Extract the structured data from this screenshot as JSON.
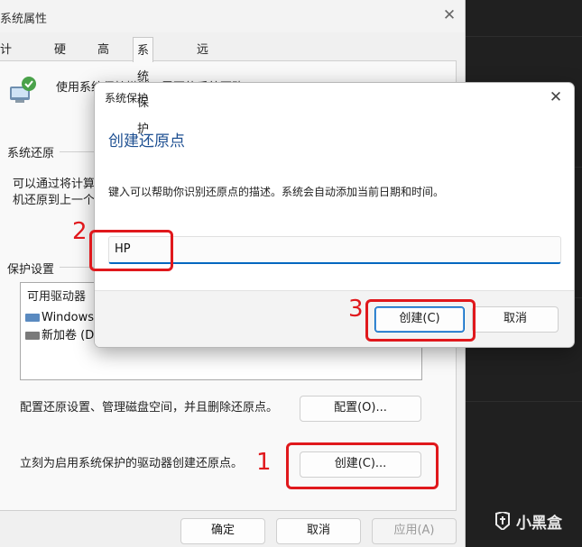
{
  "parent_window": {
    "title": "系统属性",
    "close_glyph": "✕",
    "tabs": [
      {
        "label": "计算机名"
      },
      {
        "label": "硬件"
      },
      {
        "label": "高级"
      },
      {
        "label": "系统保护"
      },
      {
        "label": "远程"
      }
    ],
    "active_tab": "系统保护",
    "intro_text": "使用系统保护撤消不需要的系统更改。",
    "system_restore": {
      "group_label": "系统还原",
      "text": "可以通过将计算机还原到上一个还原点，撤消系统更改。"
    },
    "protection_settings": {
      "group_label": "保护设置",
      "column_header": "可用驱动器",
      "drives": [
        {
          "name": "Windows (C:) (系统)",
          "icon": "system-drive-icon"
        },
        {
          "name": "新加卷 (D:)",
          "icon": "drive-icon"
        }
      ]
    },
    "configure": {
      "text": "配置还原设置、管理磁盘空间，并且删除还原点。",
      "button": "配置(O)..."
    },
    "create": {
      "text": "立刻为启用系统保护的驱动器创建还原点。",
      "button": "创建(C)..."
    },
    "footer_buttons": {
      "ok": "确定",
      "cancel": "取消",
      "apply": "应用(A)"
    }
  },
  "dialog": {
    "title": "系统保护",
    "close_glyph": "✕",
    "heading": "创建还原点",
    "description": "键入可以帮助你识别还原点的描述。系统会自动添加当前日期和时间。",
    "input_value": "HP",
    "create_button": "创建(C)",
    "cancel_button": "取消"
  },
  "annotations": {
    "step1": "1",
    "step2": "2",
    "step3": "3",
    "color": "#e0181c"
  },
  "watermark": {
    "text": "小黑盒"
  }
}
